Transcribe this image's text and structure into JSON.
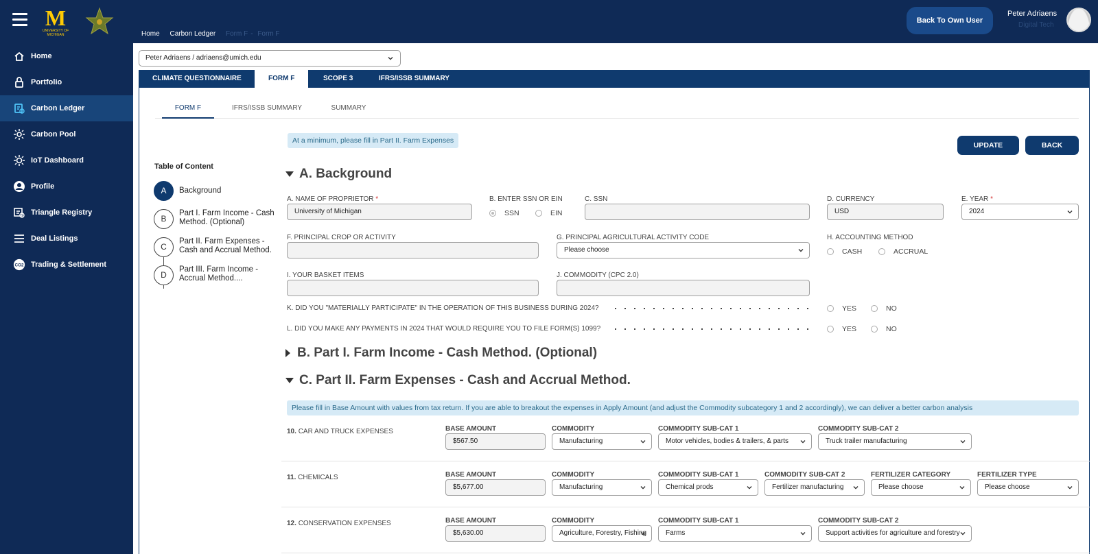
{
  "header": {
    "logo_text": "M",
    "logo_sub": "UNIVERSITY OF MICHIGAN",
    "breadcrumb": [
      "Home",
      "Carbon Ledger",
      "Form F",
      "Form F"
    ],
    "back_button": "Back To Own User",
    "user_name": "Peter Adriaens",
    "user_role": "Digital Tech"
  },
  "sidebar": {
    "items": [
      {
        "label": "Home",
        "icon": "home-icon"
      },
      {
        "label": "Portfolio",
        "icon": "portfolio-icon"
      },
      {
        "label": "Carbon Ledger",
        "icon": "carbon-ledger-icon",
        "active": true
      },
      {
        "label": "Carbon Pool",
        "icon": "carbon-pool-icon"
      },
      {
        "label": "IoT Dashboard",
        "icon": "iot-icon"
      },
      {
        "label": "Profile",
        "icon": "profile-icon"
      },
      {
        "label": "Triangle Registry",
        "icon": "registry-icon"
      },
      {
        "label": "Deal Listings",
        "icon": "list-icon"
      },
      {
        "label": "Trading & Settlement",
        "icon": "co2-icon"
      }
    ]
  },
  "main": {
    "user_selector": "Peter Adriaens / adriaens@umich.edu",
    "tabs": [
      "CLIMATE QUESTIONNAIRE",
      "FORM F",
      "SCOPE 3",
      "IFRS/ISSB SUMMARY"
    ],
    "active_tab": "FORM F",
    "subtabs": [
      "FORM F",
      "IFRS/ISSB SUMMARY",
      "SUMMARY"
    ],
    "notice": "At a minimum, please fill in Part II. Farm Expenses",
    "update_button": "UPDATE",
    "back_button": "BACK",
    "toc": {
      "title": "Table of Content",
      "items": [
        {
          "letter": "A",
          "label": "Background"
        },
        {
          "letter": "B",
          "label": "Part I. Farm Income - Cash Method. (Optional)"
        },
        {
          "letter": "C",
          "label": "Part II. Farm Expenses - Cash and Accrual Method."
        },
        {
          "letter": "D",
          "label": "Part III. Farm Income - Accrual Method...."
        }
      ]
    },
    "section_a": {
      "title": "A. Background",
      "name_label": "A. NAME OF PROPRIETOR",
      "name_value": "University of Michigan",
      "ssn_ein_label": "B. ENTER SSN OR EIN",
      "ssn_option": "SSN",
      "ein_option": "EIN",
      "ssn_label": "C. SSN",
      "ssn_value": "",
      "currency_label": "D. CURRENCY",
      "currency_value": "USD",
      "year_label": "E. YEAR",
      "year_value": "2024",
      "crop_label": "F. PRINCIPAL CROP OR ACTIVITY",
      "crop_value": "",
      "activity_code_label": "G. PRINCIPAL AGRICULTURAL ACTIVITY CODE",
      "activity_code_value": "Please choose",
      "accounting_label": "H. ACCOUNTING METHOD",
      "cash_option": "CASH",
      "accrual_option": "ACCRUAL",
      "basket_label": "I. YOUR BASKET ITEMS",
      "basket_value": "",
      "commodity_label": "J. COMMODITY (CPC 2.0)",
      "commodity_value": "",
      "question_k": "K. DID YOU \"MATERIALLY PARTICIPATE\" IN THE OPERATION OF THIS BUSINESS DURING 2024?",
      "question_l": "L. DID YOU MAKE ANY PAYMENTS IN 2024 THAT WOULD REQUIRE YOU TO FILE FORM(S) 1099?",
      "yes": "YES",
      "no": "NO"
    },
    "section_b": {
      "title": "B. Part I. Farm Income - Cash Method. (Optional)"
    },
    "section_c": {
      "title": "C. Part II. Farm Expenses - Cash and Accrual Method.",
      "notice": "Please fill in Base Amount with values from tax return. If you are able to breakout the expenses in Apply Amount (and adjust the Commodity subcategory 1 and 2 accordingly), we can deliver a better carbon analysis",
      "rows": [
        {
          "num": "10.",
          "label": "CAR AND TRUCK EXPENSES",
          "base_label": "BASE AMOUNT",
          "base_value": "$567.50",
          "commodity_label": "COMMODITY",
          "commodity_value": "Manufacturing",
          "sub1_label": "COMMODITY SUB-CAT 1",
          "sub1_value": "Motor vehicles, bodies & trailers, & parts",
          "sub2_label": "COMMODITY SUB-CAT 2",
          "sub2_value": "Truck trailer manufacturing"
        },
        {
          "num": "11.",
          "label": "CHEMICALS",
          "base_label": "BASE AMOUNT",
          "base_value": "$5,677.00",
          "commodity_label": "COMMODITY",
          "commodity_value": "Manufacturing",
          "sub1_label": "COMMODITY SUB-CAT 1",
          "sub1_value": "Chemical prods",
          "sub2_label": "COMMODITY SUB-CAT 2",
          "sub2_value": "Fertilizer manufacturing",
          "fert_cat_label": "FERTILIZER CATEGORY",
          "fert_cat_value": "Please choose",
          "fert_type_label": "FERTILIZER TYPE",
          "fert_type_value": "Please choose"
        },
        {
          "num": "12.",
          "label": "CONSERVATION EXPENSES",
          "base_label": "BASE AMOUNT",
          "base_value": "$5,630.00",
          "commodity_label": "COMMODITY",
          "commodity_value": "Agriculture, Forestry, Fishing",
          "sub1_label": "COMMODITY SUB-CAT 1",
          "sub1_value": "Farms",
          "sub2_label": "COMMODITY SUB-CAT 2",
          "sub2_value": "Support activities for agriculture and forestry"
        }
      ]
    }
  },
  "colors": {
    "navy": "#0f2a56",
    "tab_blue": "#0f3a6e",
    "active_sidebar": "#18457a",
    "notice_bg": "#d6eaf6",
    "accent_yellow": "#ffcb05"
  }
}
